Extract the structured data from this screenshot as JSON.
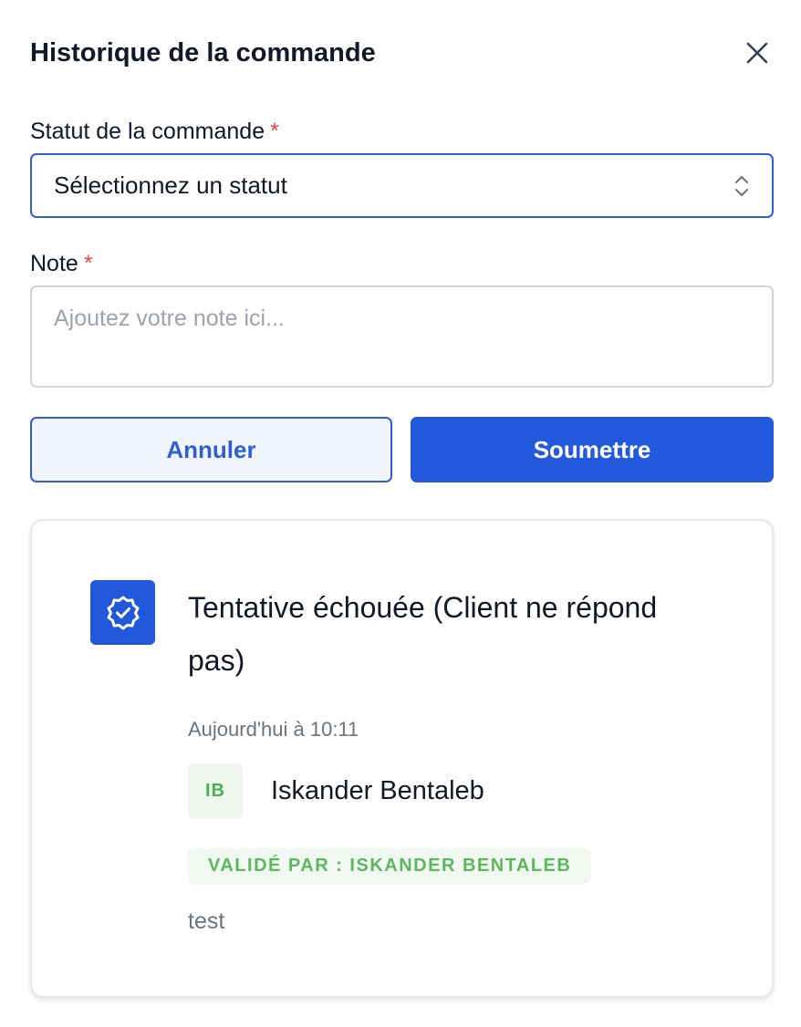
{
  "modal": {
    "title": "Historique de la commande"
  },
  "form": {
    "status_label": "Statut de la commande",
    "status_required": "*",
    "status_value": "Sélectionnez un statut",
    "note_label": "Note",
    "note_required": "*",
    "note_placeholder": "Ajoutez votre note ici..."
  },
  "actions": {
    "cancel_label": "Annuler",
    "submit_label": "Soumettre"
  },
  "history": {
    "event_title": "Tentative échouée (Client ne répond pas)",
    "event_time": "Aujourd'hui à 10:11",
    "user_initials": "IB",
    "user_name": "Iskander Bentaleb",
    "validated_badge": "VALIDÉ PAR : ISKANDER BENTALEB",
    "note": "test"
  },
  "colors": {
    "primary": "#2258dc",
    "required": "#ef4444",
    "success": "#5cb85c"
  },
  "icons": {
    "close": "close-icon",
    "select": "chevron-up-down-icon",
    "status": "badge-check-icon"
  }
}
